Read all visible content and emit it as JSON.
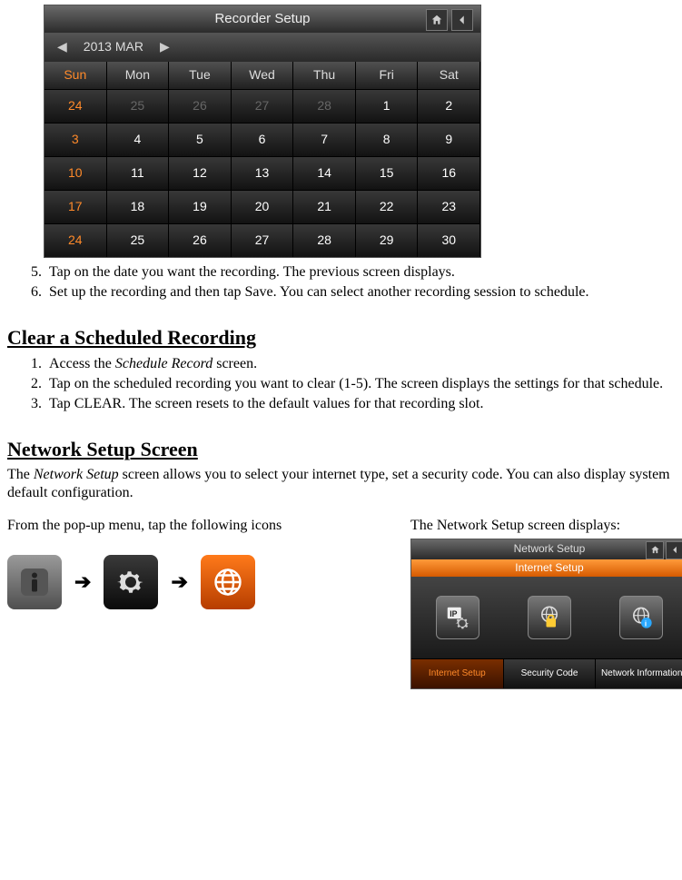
{
  "calendar": {
    "title": "Recorder Setup",
    "month_label": "2013 MAR",
    "dow": [
      "Sun",
      "Mon",
      "Tue",
      "Wed",
      "Thu",
      "Fri",
      "Sat"
    ],
    "weeks": [
      [
        {
          "v": "24",
          "dim": true,
          "sun": true
        },
        {
          "v": "25",
          "dim": true
        },
        {
          "v": "26",
          "dim": true
        },
        {
          "v": "27",
          "dim": true
        },
        {
          "v": "28",
          "dim": true
        },
        {
          "v": "1"
        },
        {
          "v": "2"
        }
      ],
      [
        {
          "v": "3",
          "sun": true
        },
        {
          "v": "4"
        },
        {
          "v": "5"
        },
        {
          "v": "6"
        },
        {
          "v": "7"
        },
        {
          "v": "8"
        },
        {
          "v": "9"
        }
      ],
      [
        {
          "v": "10",
          "sun": true
        },
        {
          "v": "11"
        },
        {
          "v": "12"
        },
        {
          "v": "13"
        },
        {
          "v": "14"
        },
        {
          "v": "15"
        },
        {
          "v": "16"
        }
      ],
      [
        {
          "v": "17",
          "sun": true
        },
        {
          "v": "18"
        },
        {
          "v": "19"
        },
        {
          "v": "20"
        },
        {
          "v": "21"
        },
        {
          "v": "22"
        },
        {
          "v": "23"
        }
      ],
      [
        {
          "v": "24",
          "sun": true
        },
        {
          "v": "25"
        },
        {
          "v": "26"
        },
        {
          "v": "27"
        },
        {
          "v": "28"
        },
        {
          "v": "29"
        },
        {
          "v": "30"
        }
      ]
    ]
  },
  "steps_a": {
    "start": 5,
    "items": [
      "Tap on the date you want the recording. The previous screen displays.",
      "Set up the recording and then tap Save. You can select another recording session to schedule."
    ]
  },
  "heading_clear": "Clear a Scheduled Recording",
  "steps_b": {
    "start": 1,
    "items": [
      {
        "prefix": "Access the ",
        "italic": "Schedule Record",
        "suffix": " screen."
      },
      {
        "text": "Tap on the scheduled recording you want to clear (1-5). The screen displays the settings for that schedule."
      },
      {
        "text": "Tap CLEAR. The screen resets to the default values for that recording slot."
      }
    ]
  },
  "heading_net": "Network Setup Screen",
  "net_intro": {
    "prefix": "The ",
    "italic": "Network Setup",
    "suffix": " screen allows you to select your internet type, set a security code. You can also display system default configuration."
  },
  "col_left_text": "From the pop-up menu, tap the following icons",
  "col_right_text": "The Network Setup screen displays:",
  "arrow": "➔",
  "network_panel": {
    "title": "Network Setup",
    "subtitle": "Internet Setup",
    "footer": [
      "Internet Setup",
      "Security Code",
      "Network Information"
    ]
  }
}
